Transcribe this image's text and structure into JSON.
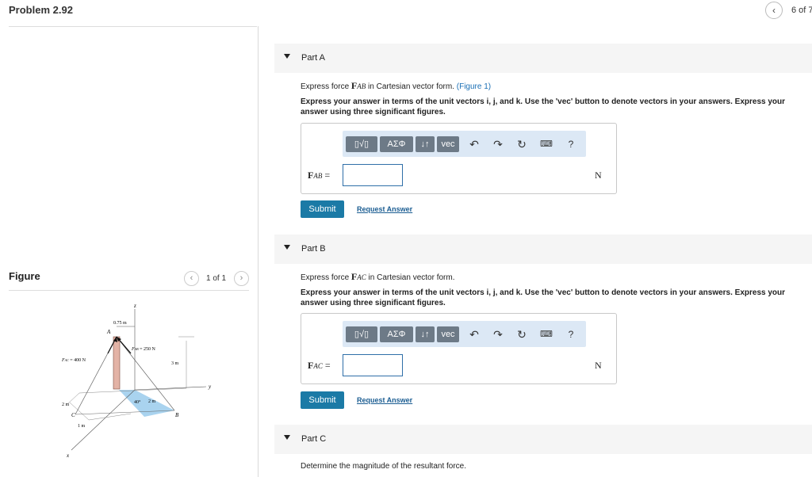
{
  "header": {
    "title": "Problem 2.92",
    "prev_icon": "chevron-left-icon",
    "page_count": "6 of 7"
  },
  "figure_panel": {
    "heading": "Figure",
    "count": "1 of 1",
    "prev_icon": "chevron-left-icon",
    "next_icon": "chevron-right-icon",
    "labels": {
      "z": "z",
      "y": "y",
      "x": "x",
      "A": "A",
      "B": "B",
      "C": "C",
      "d075": "0.75 m",
      "fab": "F",
      "fab_sub": "AB",
      "fab_val": "= 250 N",
      "fac": "F",
      "fac_sub": "AC",
      "fac_val": "= 400 N",
      "d3": "3 m",
      "d2a": "2 m",
      "d2b": "2 m",
      "d1": "1 m",
      "angle": "40°"
    }
  },
  "toolbar": {
    "templates": "▯√▯",
    "symbols": "ΑΣΦ",
    "sort": "↓↑",
    "vec": "vec",
    "undo_icon": "undo-icon",
    "redo_icon": "redo-icon",
    "reset_icon": "reset-icon",
    "keyboard_icon": "keyboard-icon",
    "help": "?"
  },
  "parts": [
    {
      "label": "Part A",
      "question": "Express force ",
      "force_symbol": "F",
      "force_sub": "AB",
      "question_tail": " in Cartesian vector form. ",
      "figure_link": "(Figure 1)",
      "instructions": "Express your answer in terms of the unit vectors i, j, and k. Use the 'vec' button to denote vectors in your answers. Express your answer using three significant figures.",
      "answer_label": "F",
      "answer_sub": "AB",
      "equals": " =",
      "answer_value": "",
      "unit": "N",
      "submit": "Submit",
      "request": "Request Answer"
    },
    {
      "label": "Part B",
      "question": "Express force ",
      "force_symbol": "F",
      "force_sub": "AC",
      "question_tail": " in Cartesian vector form.",
      "instructions": "Express your answer in terms of the unit vectors i, j, and k. Use the 'vec' button to denote vectors in your answers. Express your answer using three significant figures.",
      "answer_label": "F",
      "answer_sub": "AC",
      "equals": " =",
      "answer_value": "",
      "unit": "N",
      "submit": "Submit",
      "request": "Request Answer"
    },
    {
      "label": "Part C",
      "question": "Determine the magnitude of the resultant force."
    }
  ]
}
